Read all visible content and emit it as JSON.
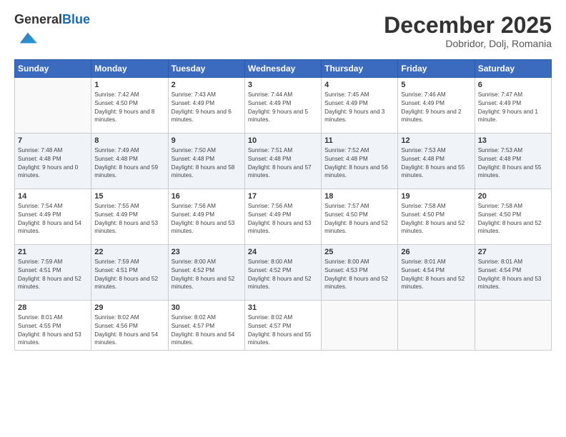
{
  "logo": {
    "general": "General",
    "blue": "Blue"
  },
  "header": {
    "month": "December 2025",
    "location": "Dobridor, Dolj, Romania"
  },
  "weekdays": [
    "Sunday",
    "Monday",
    "Tuesday",
    "Wednesday",
    "Thursday",
    "Friday",
    "Saturday"
  ],
  "weeks": [
    [
      {
        "day": "",
        "sunrise": "",
        "sunset": "",
        "daylight": ""
      },
      {
        "day": "1",
        "sunrise": "Sunrise: 7:42 AM",
        "sunset": "Sunset: 4:50 PM",
        "daylight": "Daylight: 9 hours and 8 minutes."
      },
      {
        "day": "2",
        "sunrise": "Sunrise: 7:43 AM",
        "sunset": "Sunset: 4:49 PM",
        "daylight": "Daylight: 9 hours and 6 minutes."
      },
      {
        "day": "3",
        "sunrise": "Sunrise: 7:44 AM",
        "sunset": "Sunset: 4:49 PM",
        "daylight": "Daylight: 9 hours and 5 minutes."
      },
      {
        "day": "4",
        "sunrise": "Sunrise: 7:45 AM",
        "sunset": "Sunset: 4:49 PM",
        "daylight": "Daylight: 9 hours and 3 minutes."
      },
      {
        "day": "5",
        "sunrise": "Sunrise: 7:46 AM",
        "sunset": "Sunset: 4:49 PM",
        "daylight": "Daylight: 9 hours and 2 minutes."
      },
      {
        "day": "6",
        "sunrise": "Sunrise: 7:47 AM",
        "sunset": "Sunset: 4:49 PM",
        "daylight": "Daylight: 9 hours and 1 minute."
      }
    ],
    [
      {
        "day": "7",
        "sunrise": "Sunrise: 7:48 AM",
        "sunset": "Sunset: 4:48 PM",
        "daylight": "Daylight: 9 hours and 0 minutes."
      },
      {
        "day": "8",
        "sunrise": "Sunrise: 7:49 AM",
        "sunset": "Sunset: 4:48 PM",
        "daylight": "Daylight: 8 hours and 59 minutes."
      },
      {
        "day": "9",
        "sunrise": "Sunrise: 7:50 AM",
        "sunset": "Sunset: 4:48 PM",
        "daylight": "Daylight: 8 hours and 58 minutes."
      },
      {
        "day": "10",
        "sunrise": "Sunrise: 7:51 AM",
        "sunset": "Sunset: 4:48 PM",
        "daylight": "Daylight: 8 hours and 57 minutes."
      },
      {
        "day": "11",
        "sunrise": "Sunrise: 7:52 AM",
        "sunset": "Sunset: 4:48 PM",
        "daylight": "Daylight: 8 hours and 56 minutes."
      },
      {
        "day": "12",
        "sunrise": "Sunrise: 7:53 AM",
        "sunset": "Sunset: 4:48 PM",
        "daylight": "Daylight: 8 hours and 55 minutes."
      },
      {
        "day": "13",
        "sunrise": "Sunrise: 7:53 AM",
        "sunset": "Sunset: 4:48 PM",
        "daylight": "Daylight: 8 hours and 55 minutes."
      }
    ],
    [
      {
        "day": "14",
        "sunrise": "Sunrise: 7:54 AM",
        "sunset": "Sunset: 4:49 PM",
        "daylight": "Daylight: 8 hours and 54 minutes."
      },
      {
        "day": "15",
        "sunrise": "Sunrise: 7:55 AM",
        "sunset": "Sunset: 4:49 PM",
        "daylight": "Daylight: 8 hours and 53 minutes."
      },
      {
        "day": "16",
        "sunrise": "Sunrise: 7:56 AM",
        "sunset": "Sunset: 4:49 PM",
        "daylight": "Daylight: 8 hours and 53 minutes."
      },
      {
        "day": "17",
        "sunrise": "Sunrise: 7:56 AM",
        "sunset": "Sunset: 4:49 PM",
        "daylight": "Daylight: 8 hours and 53 minutes."
      },
      {
        "day": "18",
        "sunrise": "Sunrise: 7:57 AM",
        "sunset": "Sunset: 4:50 PM",
        "daylight": "Daylight: 8 hours and 52 minutes."
      },
      {
        "day": "19",
        "sunrise": "Sunrise: 7:58 AM",
        "sunset": "Sunset: 4:50 PM",
        "daylight": "Daylight: 8 hours and 52 minutes."
      },
      {
        "day": "20",
        "sunrise": "Sunrise: 7:58 AM",
        "sunset": "Sunset: 4:50 PM",
        "daylight": "Daylight: 8 hours and 52 minutes."
      }
    ],
    [
      {
        "day": "21",
        "sunrise": "Sunrise: 7:59 AM",
        "sunset": "Sunset: 4:51 PM",
        "daylight": "Daylight: 8 hours and 52 minutes."
      },
      {
        "day": "22",
        "sunrise": "Sunrise: 7:59 AM",
        "sunset": "Sunset: 4:51 PM",
        "daylight": "Daylight: 8 hours and 52 minutes."
      },
      {
        "day": "23",
        "sunrise": "Sunrise: 8:00 AM",
        "sunset": "Sunset: 4:52 PM",
        "daylight": "Daylight: 8 hours and 52 minutes."
      },
      {
        "day": "24",
        "sunrise": "Sunrise: 8:00 AM",
        "sunset": "Sunset: 4:52 PM",
        "daylight": "Daylight: 8 hours and 52 minutes."
      },
      {
        "day": "25",
        "sunrise": "Sunrise: 8:00 AM",
        "sunset": "Sunset: 4:53 PM",
        "daylight": "Daylight: 8 hours and 52 minutes."
      },
      {
        "day": "26",
        "sunrise": "Sunrise: 8:01 AM",
        "sunset": "Sunset: 4:54 PM",
        "daylight": "Daylight: 8 hours and 52 minutes."
      },
      {
        "day": "27",
        "sunrise": "Sunrise: 8:01 AM",
        "sunset": "Sunset: 4:54 PM",
        "daylight": "Daylight: 8 hours and 53 minutes."
      }
    ],
    [
      {
        "day": "28",
        "sunrise": "Sunrise: 8:01 AM",
        "sunset": "Sunset: 4:55 PM",
        "daylight": "Daylight: 8 hours and 53 minutes."
      },
      {
        "day": "29",
        "sunrise": "Sunrise: 8:02 AM",
        "sunset": "Sunset: 4:56 PM",
        "daylight": "Daylight: 8 hours and 54 minutes."
      },
      {
        "day": "30",
        "sunrise": "Sunrise: 8:02 AM",
        "sunset": "Sunset: 4:57 PM",
        "daylight": "Daylight: 8 hours and 54 minutes."
      },
      {
        "day": "31",
        "sunrise": "Sunrise: 8:02 AM",
        "sunset": "Sunset: 4:57 PM",
        "daylight": "Daylight: 8 hours and 55 minutes."
      },
      {
        "day": "",
        "sunrise": "",
        "sunset": "",
        "daylight": ""
      },
      {
        "day": "",
        "sunrise": "",
        "sunset": "",
        "daylight": ""
      },
      {
        "day": "",
        "sunrise": "",
        "sunset": "",
        "daylight": ""
      }
    ]
  ]
}
